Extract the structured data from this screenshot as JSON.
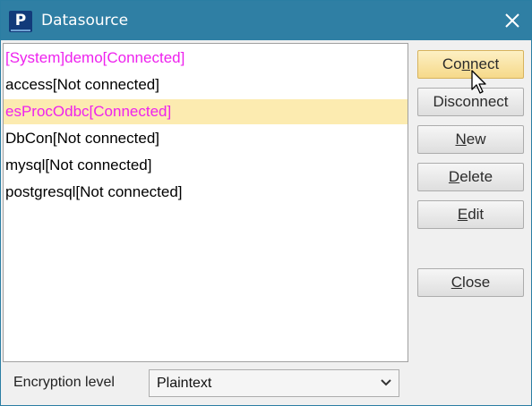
{
  "window": {
    "title": "Datasource",
    "app_icon": "P"
  },
  "datasources": [
    {
      "label": "[System]demo[Connected]",
      "connected": true,
      "selected": false
    },
    {
      "label": "access[Not connected]",
      "connected": false,
      "selected": false
    },
    {
      "label": "esProcOdbc[Connected]",
      "connected": true,
      "selected": true
    },
    {
      "label": "DbCon[Not connected]",
      "connected": false,
      "selected": false
    },
    {
      "label": "mysql[Not connected]",
      "connected": false,
      "selected": false
    },
    {
      "label": "postgresql[Not connected]",
      "connected": false,
      "selected": false
    }
  ],
  "buttons": {
    "connect": {
      "pre": "Co",
      "mnemonic": "n",
      "post": "nect"
    },
    "disconnect": {
      "pre": "Disconnect",
      "mnemonic": "",
      "post": ""
    },
    "new": {
      "pre": "",
      "mnemonic": "N",
      "post": "ew"
    },
    "delete": {
      "pre": "",
      "mnemonic": "D",
      "post": "elete"
    },
    "edit": {
      "pre": "",
      "mnemonic": "E",
      "post": "dit"
    },
    "close": {
      "pre": "",
      "mnemonic": "C",
      "post": "lose"
    }
  },
  "encryption": {
    "label": "Encryption level",
    "value": "Plaintext"
  },
  "colors": {
    "titlebar": "#2f7fa4",
    "connected_text": "#ee22ee",
    "selected_row": "#fcebb0"
  }
}
